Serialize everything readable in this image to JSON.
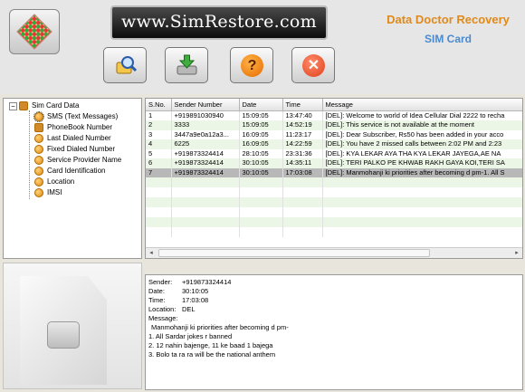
{
  "header": {
    "site_banner": "www.SimRestore.com",
    "brand_title": "Data Doctor Recovery",
    "brand_subtitle": "SIM Card",
    "icons": {
      "logo": "dotted-diamond-logo",
      "search": "search-icon",
      "save": "save-icon",
      "help": "help-icon",
      "exit": "exit-icon"
    },
    "help_glyph": "?",
    "exit_glyph": "✕"
  },
  "tree": {
    "root": "Sim Card Data",
    "toggle": "−",
    "items": [
      "SMS (Text Messages)",
      "PhoneBook Number",
      "Last Dialed Number",
      "Fixed Dialed Number",
      "Service Provider Name",
      "Card Identification",
      "Location",
      "IMSI"
    ]
  },
  "table": {
    "columns": [
      "S.No.",
      "Sender Number",
      "Date",
      "Time",
      "Message"
    ],
    "rows": [
      [
        "1",
        "+919891030940",
        "15:09:05",
        "13:47:40",
        "[DEL]: Welcome to world of Idea Cellular Dial 2222 to recha"
      ],
      [
        "2",
        "3333",
        "15:09:05",
        "14:52:19",
        "[DEL]: This service is not available at the moment"
      ],
      [
        "3",
        "3447a9e0a12a3...",
        "16:09:05",
        "11:23:17",
        "[DEL]: Dear Subscriber, Rs50 has been added in your acco"
      ],
      [
        "4",
        "6225",
        "16:09:05",
        "14:22:59",
        "[DEL]: You have 2 missed calls between 2:02 PM and 2:23"
      ],
      [
        "5",
        "+919873324414",
        "28:10:05",
        "23:31:36",
        "[DEL]: KYA LEKAR AYA THA KYA LEKAR JAYEGA,AE NA"
      ],
      [
        "6",
        "+919873324414",
        "30:10:05",
        "14:35:11",
        "[DEL]: TERI PALKO PE KHWAB RAKH GAYA KOI,TERI SA"
      ],
      [
        "7",
        "+919873324414",
        "30:10:05",
        "17:03:08",
        "[DEL]: Manmohanji ki priorities after becoming d pm-1. All S"
      ]
    ],
    "selected_row": 7,
    "scroll_left": "◂",
    "scroll_right": "▸"
  },
  "detail": {
    "sender_label": "Sender:",
    "sender": "+919873324414",
    "date_label": "Date:",
    "date": "30:10:05",
    "time_label": "Time:",
    "time": "17:03:08",
    "location_label": "Location:",
    "location": "DEL",
    "message_label": "Message:",
    "message_lines": [
      "Manmohanji ki priorities after becoming d pm-",
      "1. All Sardar jokes r banned",
      "2. 12 nahin bajenge, 11 ke baad 1 bajega",
      "3. Bolo ta ra ra will be the national anthem"
    ]
  },
  "colors": {
    "brand_orange": "#e08a1c",
    "brand_blue": "#4a8ad0",
    "row_alt": "#ecf6e6",
    "row_selected": "#b8b8b8"
  }
}
